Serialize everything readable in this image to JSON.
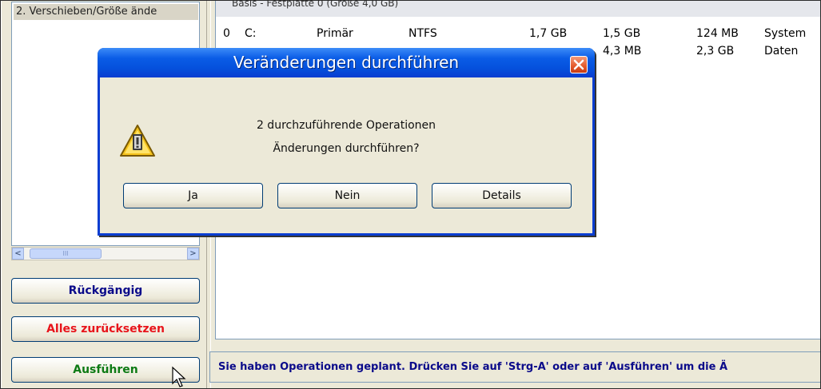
{
  "operations_list": {
    "items": [
      "2. Verschieben/Größe ände"
    ]
  },
  "scrollbar": {
    "left_arrow": "<",
    "right_arrow": ">",
    "thumb_grip": "III"
  },
  "buttons": {
    "undo": "Rückgängig",
    "reset_all": "Alles zurücksetzen",
    "execute": "Ausführen"
  },
  "colors": {
    "undo": "#0a0a8a",
    "reset_all": "#e8141b",
    "execute": "#0d7a14"
  },
  "disk": {
    "header": "Basis - Festplatte 0 (Größe 4,0 GB)",
    "rows": [
      {
        "num": "0",
        "letter": "C:",
        "type": "Primär",
        "fs": "NTFS",
        "size": "1,7 GB",
        "used": "1,5 GB",
        "free": "124 MB",
        "label": "System"
      },
      {
        "num": "",
        "letter": "",
        "type": "",
        "fs": "",
        "size": "",
        "used": "4,3 MB",
        "free": "2,3 GB",
        "label": "Daten"
      }
    ]
  },
  "status": {
    "text": "Sie haben Operationen geplant. Drücken Sie auf 'Strg-A' oder auf 'Ausführen' um die Ä"
  },
  "dialog": {
    "title": "Veränderungen durchführen",
    "line1": "2 durchzuführende Operationen",
    "line2": "Änderungen durchführen?",
    "yes": "Ja",
    "no": "Nein",
    "details": "Details",
    "icon": "warning-icon"
  }
}
